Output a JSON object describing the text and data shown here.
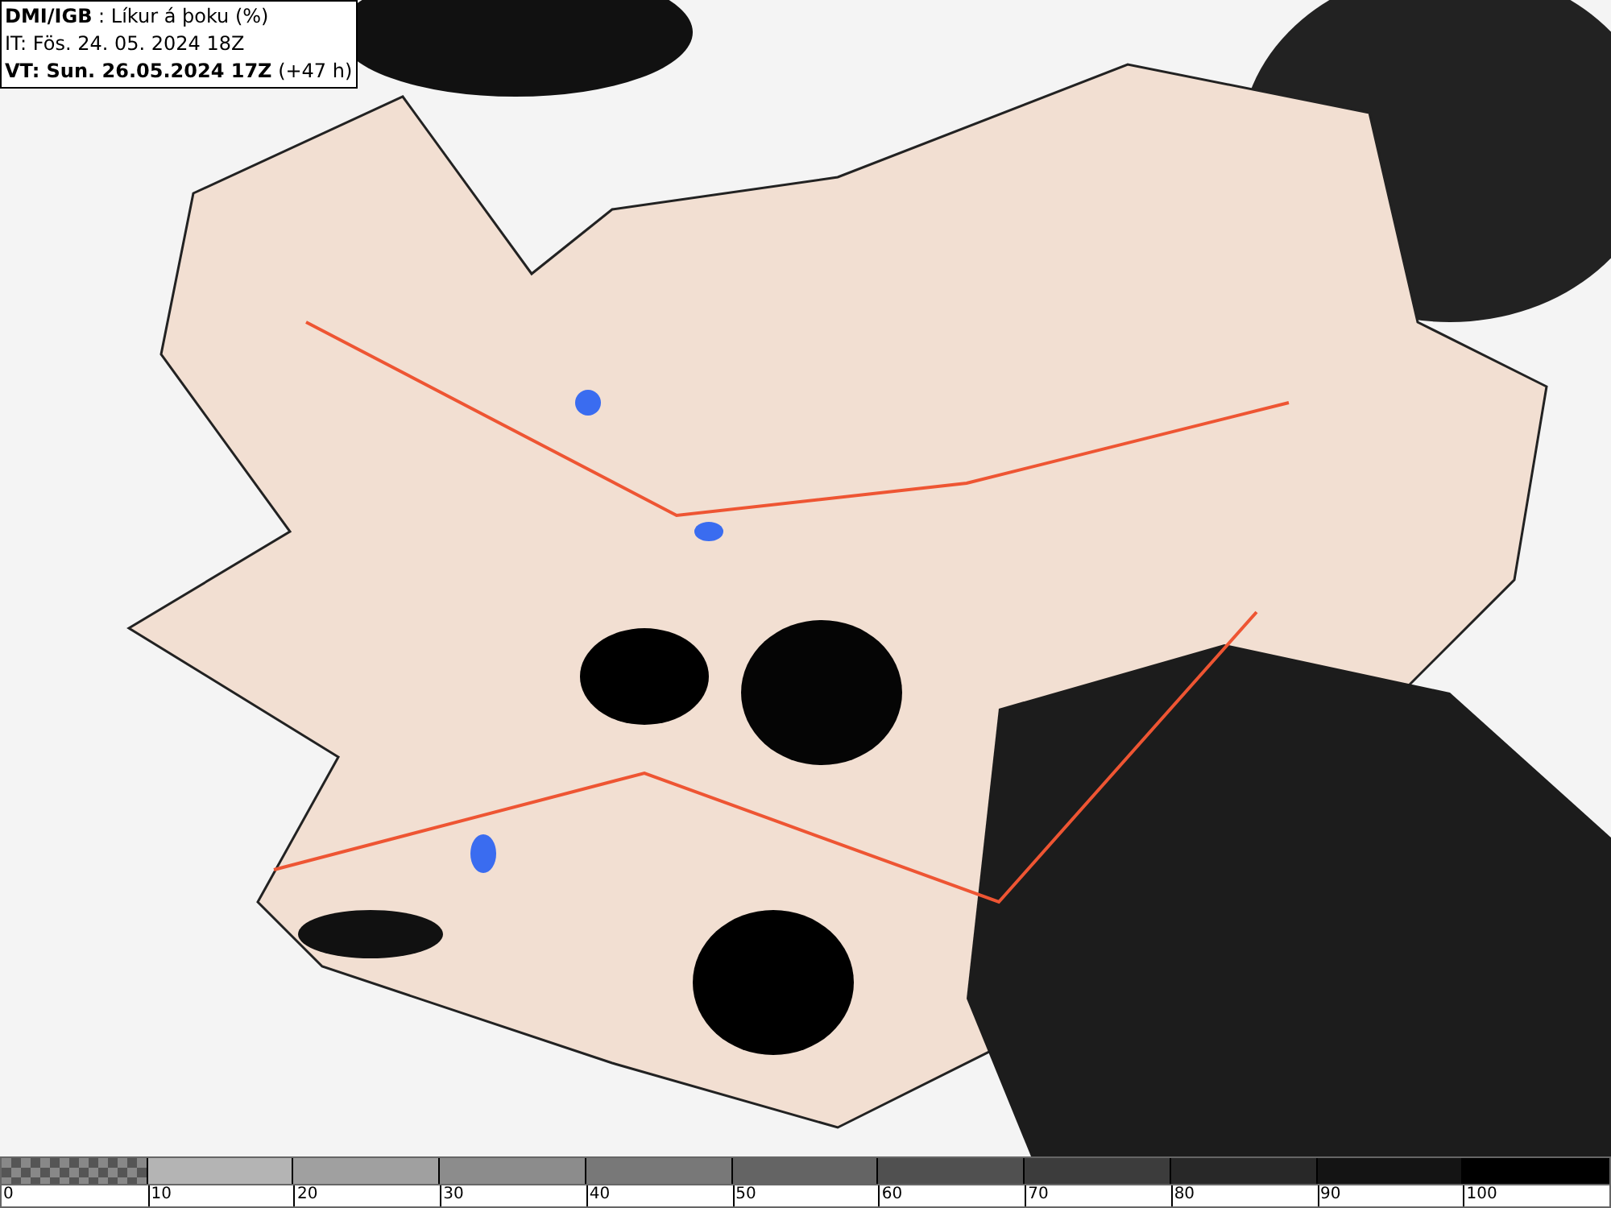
{
  "header": {
    "lines": [
      "**DMI/IGB** : Líkur á þoku (%)",
      "IT: Fös. 24. 05. 2024 18Z",
      "**VT: Sun. 26.05.2024 17Z** (+47 h)"
    ]
  },
  "legend": {
    "swatches": [
      {
        "kind": "checker"
      },
      {
        "kind": "solid",
        "color": "#b4b4b4"
      },
      {
        "kind": "solid",
        "color": "#a0a0a0"
      },
      {
        "kind": "solid",
        "color": "#8c8c8c"
      },
      {
        "kind": "solid",
        "color": "#787878"
      },
      {
        "kind": "solid",
        "color": "#646464"
      },
      {
        "kind": "solid",
        "color": "#505050"
      },
      {
        "kind": "solid",
        "color": "#3c3c3c"
      },
      {
        "kind": "solid",
        "color": "#282828"
      },
      {
        "kind": "solid",
        "color": "#141414"
      },
      {
        "kind": "solid",
        "color": "#000000"
      }
    ],
    "labels": [
      "0",
      "10",
      "20",
      "30",
      "40",
      "50",
      "60",
      "70",
      "80",
      "90",
      "100"
    ]
  }
}
